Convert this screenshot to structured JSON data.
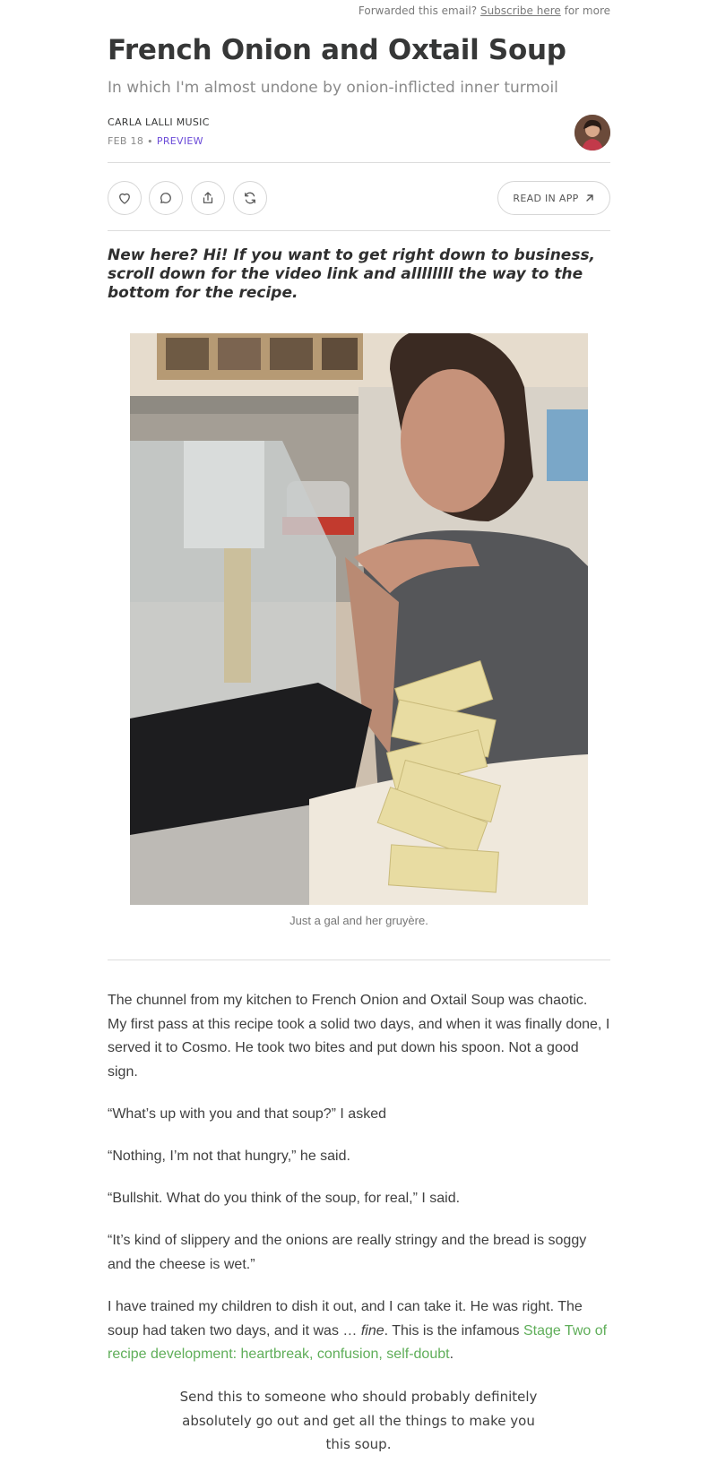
{
  "header": {
    "forwarded_text": "Forwarded this email?",
    "subscribe_link": "Subscribe here",
    "forwarded_suffix": "for more"
  },
  "post": {
    "title": "French Onion and Oxtail Soup",
    "subtitle": "In which I'm almost undone by onion-inflicted inner turmoil",
    "author": "CARLA LALLI MUSIC",
    "date": "FEB 18",
    "separator": "∙",
    "badge": "PREVIEW"
  },
  "actions": {
    "like_icon": "heart-icon",
    "comment_icon": "comment-icon",
    "share_icon": "share-icon",
    "restack_icon": "restack-icon",
    "read_in_app": "READ IN APP",
    "read_in_app_icon": "arrow-up-right-icon"
  },
  "intro": "New here? Hi! If you want to get right down to business, scroll down for the video link and allllllll the way to the bottom for the recipe.",
  "image": {
    "caption": "Just a gal and her gruyère."
  },
  "body": {
    "p1": "The chunnel from my kitchen to French Onion and Oxtail Soup was chaotic. My first pass at this recipe took a solid two days, and when it was finally done, I served it to Cosmo. He took two bites and put down his spoon. Not a good sign.",
    "p2": "“What’s up with you and that soup?” I asked",
    "p3": "“Nothing, I’m not that hungry,” he said.",
    "p4": "“Bullshit. What do you think of the soup, for real,” I said.",
    "p5": "“It’s kind of slippery and the onions are really stringy and the bread is soggy and the cheese is wet.”",
    "p6_a": "I have trained my children to dish it out, and I can take it. He was right. The soup had taken two days, and it was … ",
    "p6_em": "fine",
    "p6_b": ". This is the infamous ",
    "p6_link": "Stage Two of recipe development: heartbreak, confusion, self-doubt",
    "p6_c": "."
  },
  "cta": "Send this to someone who should probably definitely absolutely go out and get all the things to make you this soup.",
  "colors": {
    "accent_purple": "#6b4bd8",
    "link_green": "#5fae59"
  }
}
